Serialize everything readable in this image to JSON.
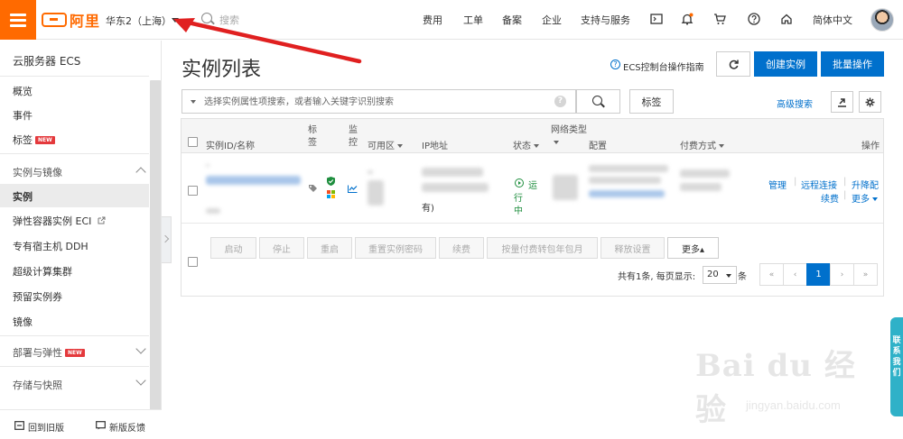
{
  "header": {
    "logo_text": "阿里",
    "region": "华东2（上海）",
    "search_placeholder": "搜索",
    "nav": [
      "费用",
      "工单",
      "备案",
      "企业",
      "支持与服务"
    ],
    "language": "简体中文"
  },
  "sidebar": {
    "title": "云服务器 ECS",
    "items_top": [
      "概览",
      "事件",
      "标签"
    ],
    "new_badge": "NEW",
    "group_instances": "实例与镜像",
    "instance_items": [
      "实例",
      "弹性容器实例 ECI",
      "专有宿主机 DDH",
      "超级计算集群",
      "预留实例券",
      "镜像"
    ],
    "group_deploy": "部署与弹性",
    "group_storage": "存储与快照",
    "footer_old": "回到旧版",
    "footer_feedback": "新版反馈"
  },
  "main": {
    "title": "实例列表",
    "guide_link": "ECS控制台操作指南",
    "create_button": "创建实例",
    "batch_button": "批量操作",
    "search_placeholder": "选择实例属性项搜索，或者输入关键字识别搜索",
    "tag_button": "标签",
    "advanced_search": "高级搜索"
  },
  "table": {
    "headers": {
      "id": "实例ID/名称",
      "tag": "标签",
      "monitor": "监控",
      "zone": "可用区",
      "ip": "IP地址",
      "status": "状态",
      "network": "网络类型",
      "config": "配置",
      "billing": "付费方式",
      "actions": "操作"
    },
    "row": {
      "ip_suffix": "有)",
      "status": "运行中",
      "actions": [
        "管理",
        "远程连接",
        "升降配",
        "续费",
        "更多"
      ]
    },
    "bulk_buttons": [
      "启动",
      "停止",
      "重启",
      "重置实例密码",
      "续费",
      "按量付费转包年包月",
      "释放设置",
      "更多▴"
    ],
    "summary_prefix": "共有1条, 每页显示:",
    "page_size": "20",
    "summary_suffix": "条",
    "pager": [
      "«",
      "‹",
      "1",
      "›",
      "»"
    ]
  },
  "floating": {
    "contact": "联系我们"
  },
  "watermark": {
    "main": "Bai du 经验",
    "sub": "jingyan.baidu.com"
  },
  "colors": {
    "brand": "#ff6a00",
    "primary": "#0070cc",
    "running": "#1e8e3e",
    "badge": "#e4393c",
    "contact": "#2fb1c8"
  }
}
